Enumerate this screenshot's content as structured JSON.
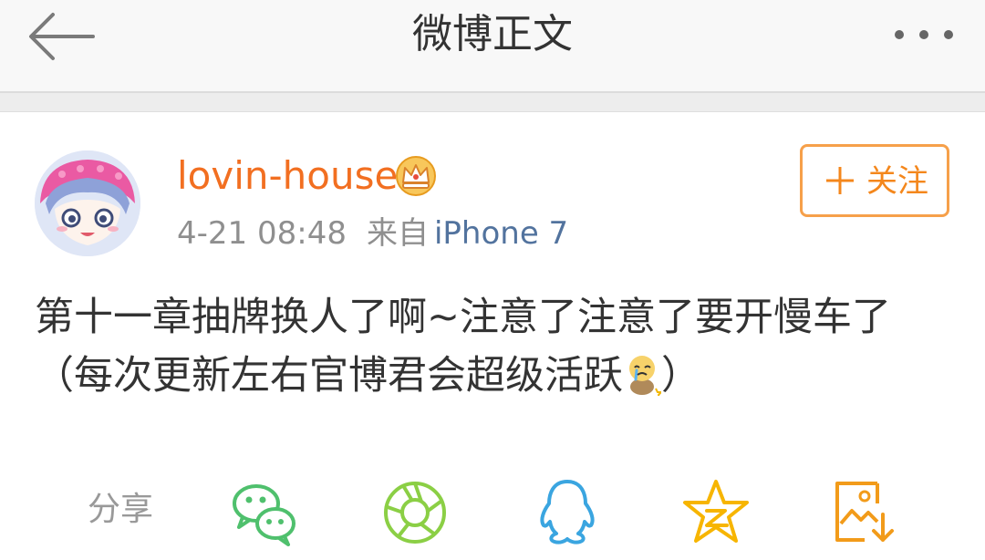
{
  "header": {
    "title": "微博正文",
    "back_icon": "arrow-left-icon",
    "more_icon": "more-dots-icon"
  },
  "post": {
    "username": "lovin-house",
    "badge_icon": "crown-icon",
    "time": "4-21 08:48",
    "source_label": "来自",
    "device": "iPhone 7",
    "follow_label": "关注",
    "text_before_emoji": "第十一章抽牌换人了啊~注意了注意了要开慢车了（每次更新左右官博君会超级活跃",
    "emoji_icon": "cry-emoji-icon",
    "text_after_emoji": "）"
  },
  "share": {
    "label": "分享",
    "icons": [
      "wechat-icon",
      "moments-icon",
      "qq-icon",
      "qzone-icon",
      "save-image-icon"
    ]
  },
  "colors": {
    "username": "#f26f21",
    "follow": "#f6a04a",
    "device": "#52739e",
    "wechat": "#4fc06d",
    "moments": "#8bcf45",
    "qq": "#3aa5e0",
    "qzone": "#f7b500",
    "save": "#f29b1a"
  }
}
